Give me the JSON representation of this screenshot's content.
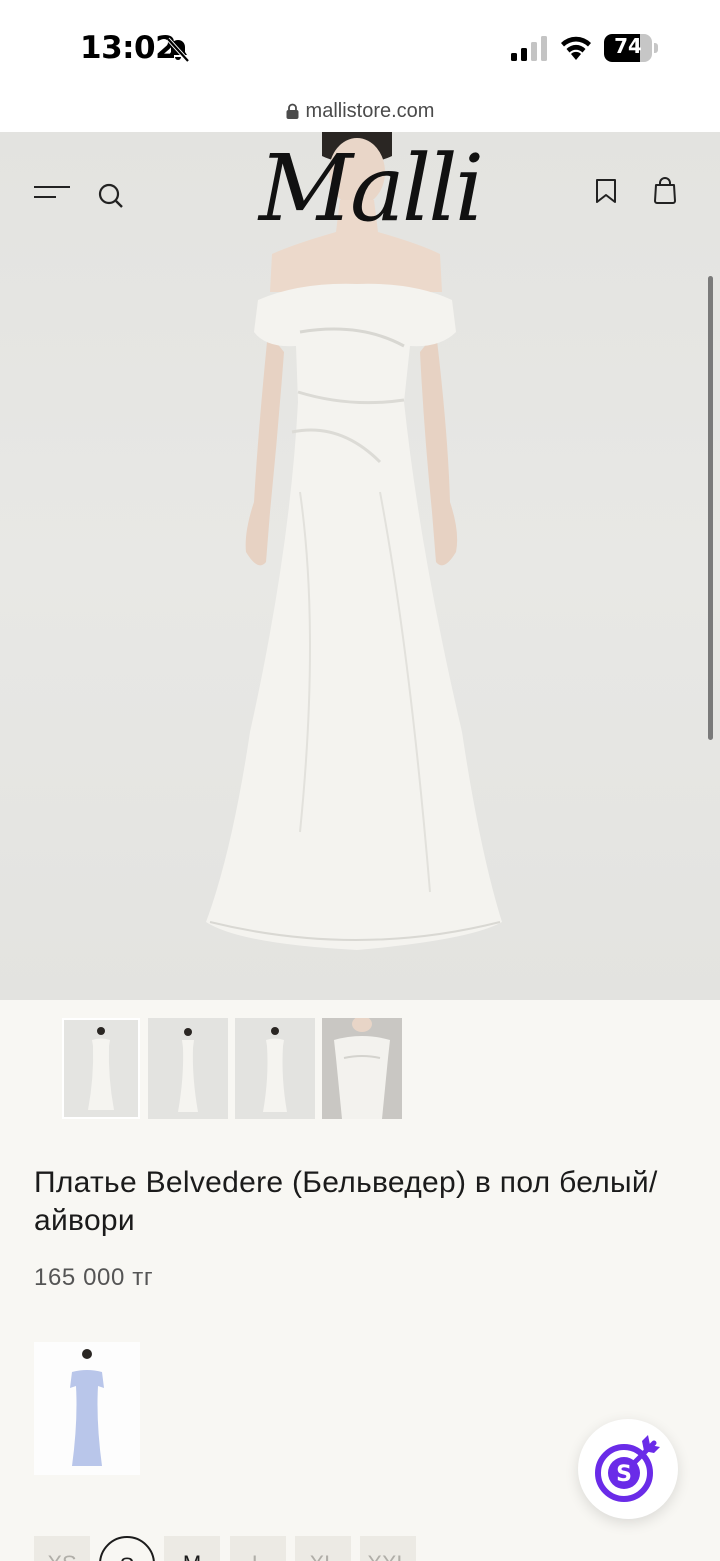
{
  "status_bar": {
    "time": "13:02",
    "battery_percent": "74",
    "battery_level": 0.74
  },
  "browser": {
    "url": "mallistore.com"
  },
  "header": {
    "logo_text": "Malli",
    "icons": [
      "menu-icon",
      "search-icon",
      "bookmark-icon",
      "bag-icon"
    ]
  },
  "product": {
    "title": "Платье Belvedere (Бельведер) в пол белый/айвори",
    "price": "165 000 тг",
    "thumbnails_count": 4,
    "selected_thumbnail": 1
  },
  "sizes": [
    {
      "label": "XS",
      "state": "unavailable"
    },
    {
      "label": "S",
      "state": "selected"
    },
    {
      "label": "M",
      "state": "available"
    },
    {
      "label": "L",
      "state": "unavailable"
    },
    {
      "label": "XL",
      "state": "unavailable"
    },
    {
      "label": "XXL",
      "state": "unavailable"
    }
  ],
  "colors": {
    "page_bg": "#f8f7f3",
    "fab_accent": "#6a2be8",
    "text": "#1c1c1c"
  }
}
